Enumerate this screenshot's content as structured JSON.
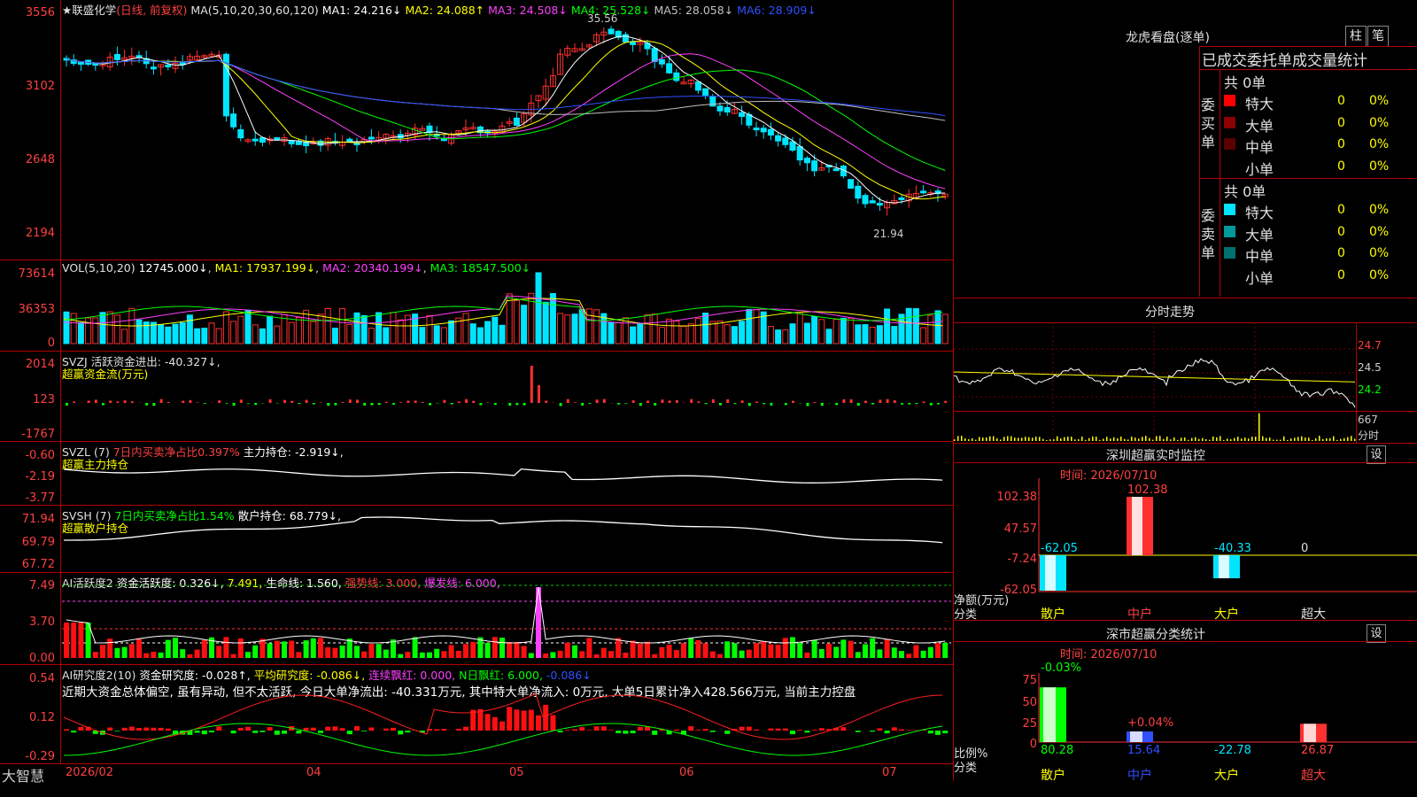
{
  "main": {
    "title": "★联盛化学",
    "mode": "(日线, 前复权)",
    "ma_header": "MA(5,10,20,30,60,120)",
    "ma1": "MA1: 24.216↓",
    "ma2": "MA2: 24.088↑",
    "ma3": "MA3: 24.508↓",
    "ma4": "MA4: 25.528↓",
    "ma5": "MA5: 28.058↓",
    "ma6": "MA6: 28.909↓",
    "y_labels": [
      "3556",
      "3102",
      "2648",
      "2194"
    ],
    "high_label": "35.56",
    "low_label": "21.94"
  },
  "vol": {
    "header": "VOL(5,10,20)",
    "value": "12745.000↓",
    "ma1": "MA1: 17937.199↓",
    "ma2": "MA2: 20340.199↓",
    "ma3": "MA3: 18547.500↓",
    "y_labels": [
      "73614",
      "36353",
      "0"
    ]
  },
  "svzj": {
    "header": "SVZJ  活跃资金进出: -40.327↓,",
    "sub": "超赢资金流(万元)",
    "y_labels": [
      "2014",
      "123",
      "-1767"
    ]
  },
  "svzl": {
    "name": "SVZL (7)",
    "ratio": "7日内买卖净占比0.397%",
    "pos": "主力持仓: -2.919↓,",
    "sub": "超赢主力持仓",
    "y_labels": [
      "-0.60",
      "-2.19",
      "-3.77"
    ]
  },
  "svsh": {
    "name": "SVSH (7)",
    "ratio": "7日内买卖净占比1.54%",
    "pos": "散户持仓: 68.779↓,",
    "sub": "超赢散户持仓",
    "y_labels": [
      "71.94",
      "69.79",
      "67.72"
    ]
  },
  "ai1": {
    "name": "AI活跃度2",
    "act": "资金活跃度: 0.326↓,",
    "v2": "7.491,",
    "life": "生命线: 1.560,",
    "strong": "强势线: 3.000,",
    "burst": "爆发线: 6.000,",
    "y_labels": [
      "7.49",
      "3.70",
      "0.00"
    ]
  },
  "ai2": {
    "name": "AI研究度2(10)",
    "res": "资金研究度: -0.028↑,",
    "avg": "平均研究度: -0.086↓,",
    "red": "连续飘红: 0.000,",
    "nred": "N日飘红: 6.000,",
    "tail": "-0.086↓",
    "comment": "近期大资金总体偏空, 虽有异动, 但不太活跃, 今日大单净流出: -40.331万元, 其中特大单净流入: 0万元, 大单5日累计净入428.566万元, 当前主力控盘",
    "y_labels": [
      "0.54",
      "0.12",
      "-0.29"
    ]
  },
  "xaxis": {
    "app": "大智慧",
    "labels": [
      "2026/02",
      "04",
      "05",
      "06",
      "07"
    ]
  },
  "right": {
    "lhb_title": "龙虎看盘(逐单)",
    "btn_zhu": "柱",
    "btn_bi": "笔",
    "stat_title": "已成交委托单成交量统计",
    "buy_label": "委买单",
    "sell_label": "委卖单",
    "buy_total": "共 0单",
    "sell_total": "共 0单",
    "buy_rows": [
      {
        "name": "特大",
        "count": "0",
        "pct": "0%",
        "color": "#ff0000"
      },
      {
        "name": "大单",
        "count": "0",
        "pct": "0%",
        "color": "#8b0000"
      },
      {
        "name": "中单",
        "count": "0",
        "pct": "0%",
        "color": "#5a0000"
      },
      {
        "name": "小单",
        "count": "0",
        "pct": "0%",
        "color": ""
      }
    ],
    "sell_rows": [
      {
        "name": "特大",
        "count": "0",
        "pct": "0%",
        "color": "#00e5ff"
      },
      {
        "name": "大单",
        "count": "0",
        "pct": "0%",
        "color": "#009a9a"
      },
      {
        "name": "中单",
        "count": "0",
        "pct": "0%",
        "color": "#007070"
      },
      {
        "name": "小单",
        "count": "0",
        "pct": "0%",
        "color": ""
      }
    ],
    "fs_title": "分时走势",
    "fs_y": [
      "24.7",
      "24.5",
      "24.2",
      "667"
    ],
    "fs_unit": "分时",
    "mon_title": "深圳超赢实时监控",
    "set1": "设",
    "mon_time": "时间: 2026/07/10",
    "mon_y": [
      "102.38",
      "47.57",
      "-7.24",
      "-62.05"
    ],
    "mon_unit": "净额(万元)",
    "mon_cat": "分类",
    "mon_values": [
      "-62.05",
      "102.38",
      "-40.33",
      "0"
    ],
    "cats": [
      "散户",
      "中户",
      "大户",
      "超大"
    ],
    "cls_title": "深市超赢分类统计",
    "set2": "设",
    "cls_time": "时间: 2026/07/10",
    "cls_y": [
      "75",
      "50",
      "25",
      "0"
    ],
    "cls_unit": "比例%",
    "cls_cat": "分类",
    "cls_top": [
      "-0.03%",
      "+0.04%"
    ],
    "cls_values": [
      "80.28",
      "15.64",
      "-22.78",
      "26.87"
    ]
  },
  "chart_data": {
    "type": "bar",
    "categories": [
      "散户",
      "中户",
      "大户",
      "超大"
    ],
    "values": [
      -62.05,
      102.38,
      -40.33,
      0
    ],
    "ylim": [
      -62.05,
      102.38
    ]
  }
}
